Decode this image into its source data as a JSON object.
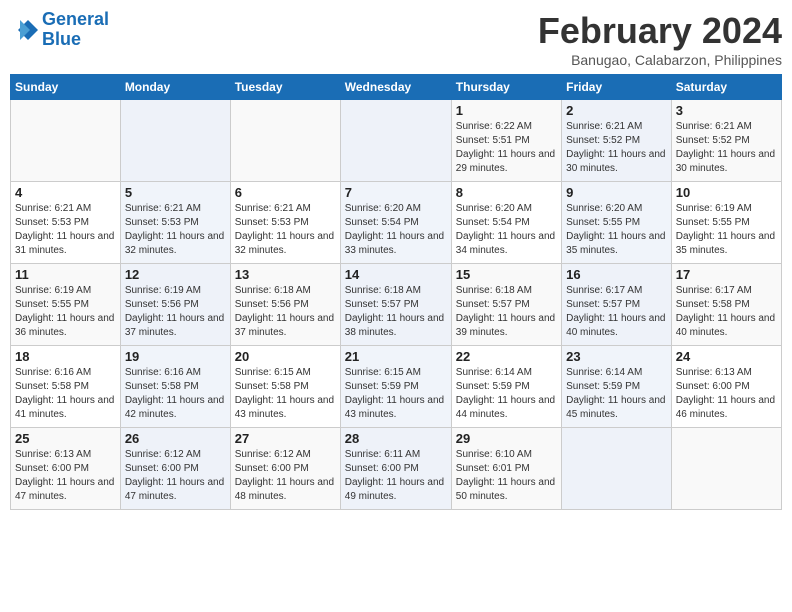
{
  "logo": {
    "line1": "General",
    "line2": "Blue"
  },
  "title": "February 2024",
  "subtitle": "Banugao, Calabarzon, Philippines",
  "days_header": [
    "Sunday",
    "Monday",
    "Tuesday",
    "Wednesday",
    "Thursday",
    "Friday",
    "Saturday"
  ],
  "weeks": [
    [
      {
        "day": "",
        "info": ""
      },
      {
        "day": "",
        "info": ""
      },
      {
        "day": "",
        "info": ""
      },
      {
        "day": "",
        "info": ""
      },
      {
        "day": "1",
        "info": "Sunrise: 6:22 AM\nSunset: 5:51 PM\nDaylight: 11 hours and 29 minutes."
      },
      {
        "day": "2",
        "info": "Sunrise: 6:21 AM\nSunset: 5:52 PM\nDaylight: 11 hours and 30 minutes."
      },
      {
        "day": "3",
        "info": "Sunrise: 6:21 AM\nSunset: 5:52 PM\nDaylight: 11 hours and 30 minutes."
      }
    ],
    [
      {
        "day": "4",
        "info": "Sunrise: 6:21 AM\nSunset: 5:53 PM\nDaylight: 11 hours and 31 minutes."
      },
      {
        "day": "5",
        "info": "Sunrise: 6:21 AM\nSunset: 5:53 PM\nDaylight: 11 hours and 32 minutes."
      },
      {
        "day": "6",
        "info": "Sunrise: 6:21 AM\nSunset: 5:53 PM\nDaylight: 11 hours and 32 minutes."
      },
      {
        "day": "7",
        "info": "Sunrise: 6:20 AM\nSunset: 5:54 PM\nDaylight: 11 hours and 33 minutes."
      },
      {
        "day": "8",
        "info": "Sunrise: 6:20 AM\nSunset: 5:54 PM\nDaylight: 11 hours and 34 minutes."
      },
      {
        "day": "9",
        "info": "Sunrise: 6:20 AM\nSunset: 5:55 PM\nDaylight: 11 hours and 35 minutes."
      },
      {
        "day": "10",
        "info": "Sunrise: 6:19 AM\nSunset: 5:55 PM\nDaylight: 11 hours and 35 minutes."
      }
    ],
    [
      {
        "day": "11",
        "info": "Sunrise: 6:19 AM\nSunset: 5:55 PM\nDaylight: 11 hours and 36 minutes."
      },
      {
        "day": "12",
        "info": "Sunrise: 6:19 AM\nSunset: 5:56 PM\nDaylight: 11 hours and 37 minutes."
      },
      {
        "day": "13",
        "info": "Sunrise: 6:18 AM\nSunset: 5:56 PM\nDaylight: 11 hours and 37 minutes."
      },
      {
        "day": "14",
        "info": "Sunrise: 6:18 AM\nSunset: 5:57 PM\nDaylight: 11 hours and 38 minutes."
      },
      {
        "day": "15",
        "info": "Sunrise: 6:18 AM\nSunset: 5:57 PM\nDaylight: 11 hours and 39 minutes."
      },
      {
        "day": "16",
        "info": "Sunrise: 6:17 AM\nSunset: 5:57 PM\nDaylight: 11 hours and 40 minutes."
      },
      {
        "day": "17",
        "info": "Sunrise: 6:17 AM\nSunset: 5:58 PM\nDaylight: 11 hours and 40 minutes."
      }
    ],
    [
      {
        "day": "18",
        "info": "Sunrise: 6:16 AM\nSunset: 5:58 PM\nDaylight: 11 hours and 41 minutes."
      },
      {
        "day": "19",
        "info": "Sunrise: 6:16 AM\nSunset: 5:58 PM\nDaylight: 11 hours and 42 minutes."
      },
      {
        "day": "20",
        "info": "Sunrise: 6:15 AM\nSunset: 5:58 PM\nDaylight: 11 hours and 43 minutes."
      },
      {
        "day": "21",
        "info": "Sunrise: 6:15 AM\nSunset: 5:59 PM\nDaylight: 11 hours and 43 minutes."
      },
      {
        "day": "22",
        "info": "Sunrise: 6:14 AM\nSunset: 5:59 PM\nDaylight: 11 hours and 44 minutes."
      },
      {
        "day": "23",
        "info": "Sunrise: 6:14 AM\nSunset: 5:59 PM\nDaylight: 11 hours and 45 minutes."
      },
      {
        "day": "24",
        "info": "Sunrise: 6:13 AM\nSunset: 6:00 PM\nDaylight: 11 hours and 46 minutes."
      }
    ],
    [
      {
        "day": "25",
        "info": "Sunrise: 6:13 AM\nSunset: 6:00 PM\nDaylight: 11 hours and 47 minutes."
      },
      {
        "day": "26",
        "info": "Sunrise: 6:12 AM\nSunset: 6:00 PM\nDaylight: 11 hours and 47 minutes."
      },
      {
        "day": "27",
        "info": "Sunrise: 6:12 AM\nSunset: 6:00 PM\nDaylight: 11 hours and 48 minutes."
      },
      {
        "day": "28",
        "info": "Sunrise: 6:11 AM\nSunset: 6:00 PM\nDaylight: 11 hours and 49 minutes."
      },
      {
        "day": "29",
        "info": "Sunrise: 6:10 AM\nSunset: 6:01 PM\nDaylight: 11 hours and 50 minutes."
      },
      {
        "day": "",
        "info": ""
      },
      {
        "day": "",
        "info": ""
      }
    ]
  ]
}
